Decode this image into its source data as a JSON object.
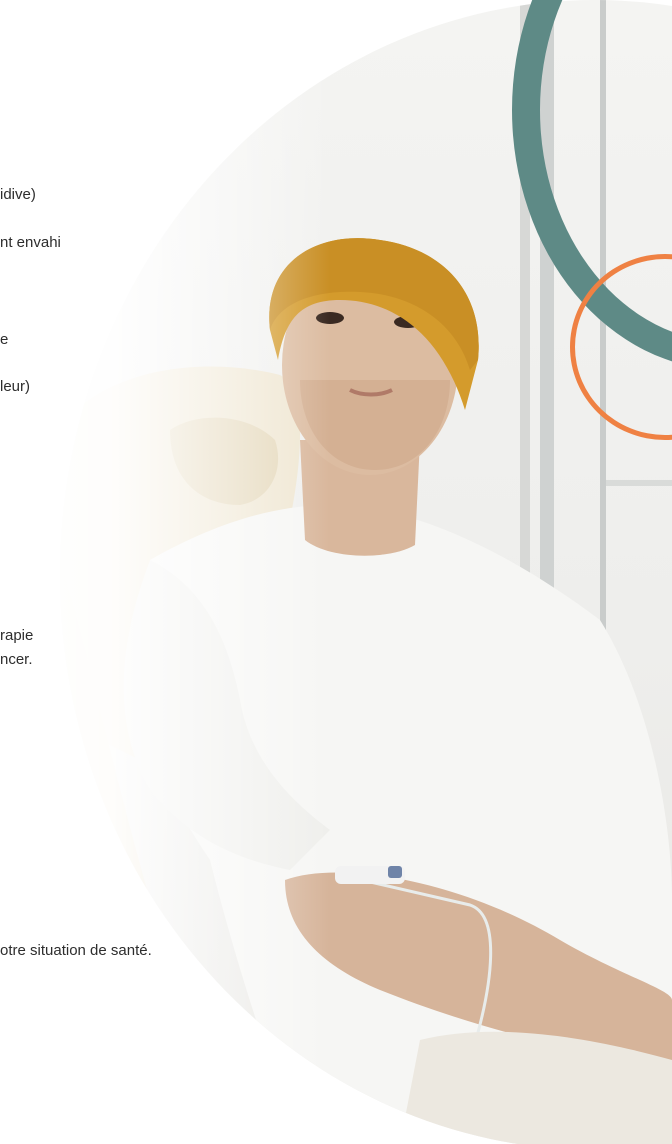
{
  "text_lines": [
    "idive)",
    "nt envahi",
    "e",
    "leur)",
    "rapie",
    "ncer.",
    "otre situation de santé."
  ],
  "colors": {
    "ring_teal": "#5e8a86",
    "ring_orange": "#ef8143",
    "beanie": "#d49b2c",
    "sweater": "#f6f6f4",
    "chair": "#ede5d2"
  }
}
